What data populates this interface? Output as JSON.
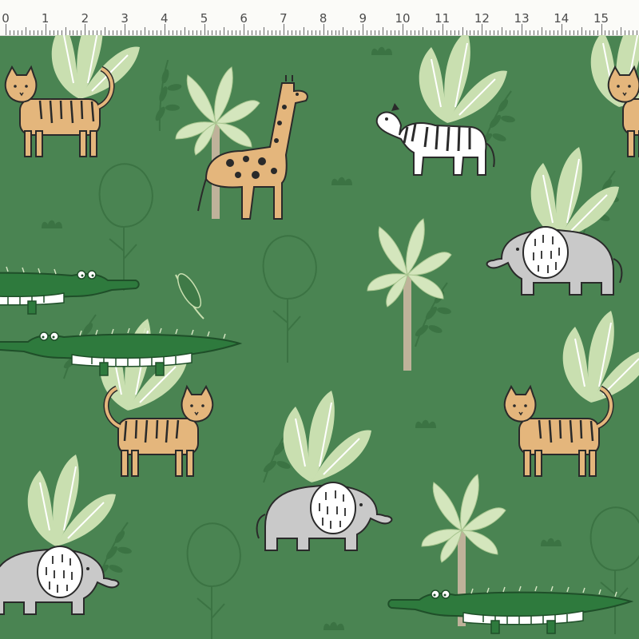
{
  "ruler": {
    "unit": "cm",
    "labels": [
      "0",
      "1",
      "2",
      "3",
      "4",
      "5",
      "6",
      "7",
      "8",
      "9",
      "10",
      "11",
      "12",
      "13",
      "14",
      "15"
    ]
  },
  "fabric": {
    "colors": {
      "background": "#4a8452",
      "foliage_dark": "#3f7a47",
      "foliage_light": "#c9dfb0",
      "tiger": "#e4b67c",
      "giraffe": "#e4b67c",
      "elephant": "#c9c9c9",
      "crocodile": "#2e7a3d",
      "zebra": "#ffffff",
      "trunk": "#bfb29a",
      "outline": "#2a2a2a"
    },
    "icons": [
      "tiger-icon",
      "giraffe-icon",
      "zebra-icon",
      "elephant-icon",
      "crocodile-icon",
      "palm-tree-icon",
      "leaf-plant-icon",
      "tree-outline-icon",
      "grass-tuft-icon"
    ]
  }
}
